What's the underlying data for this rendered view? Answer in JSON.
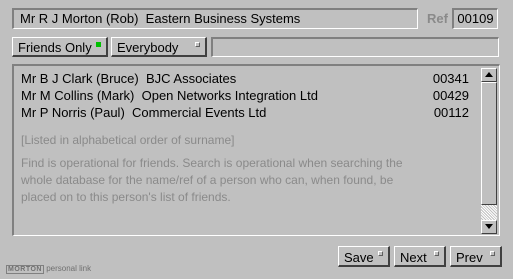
{
  "header": {
    "person_title": "Mr R J Morton (Rob)  Eastern Business Systems",
    "ref_label": "Ref",
    "ref_value": "00109"
  },
  "filters": {
    "friends_only_label": "Friends Only",
    "everybody_label": "Everybody",
    "search_value": "",
    "friends_only_active": true,
    "active_color": "#00c000"
  },
  "friends": {
    "rows": [
      {
        "name": "Mr B J Clark (Bruce)  BJC Associates",
        "ref": "00341"
      },
      {
        "name": "Mr M Collins (Mark)  Open Networks Integration Ltd",
        "ref": "00429"
      },
      {
        "name": "Mr P Norris (Paul)  Commercial Events Ltd",
        "ref": "00112"
      }
    ],
    "order_note": "[Listed in alphabetical order of surname]",
    "help_text_line1": "Find is operational for friends. Search is operational when searching the",
    "help_text_line2": "whole database for the name/ref of a person who can, when found, be",
    "help_text_line3": "placed on to this person's list of friends."
  },
  "footer": {
    "save_label": "Save",
    "next_label": "Next",
    "prev_label": "Prev",
    "logo_brand": "MORTON",
    "logo_text": "personal link"
  }
}
